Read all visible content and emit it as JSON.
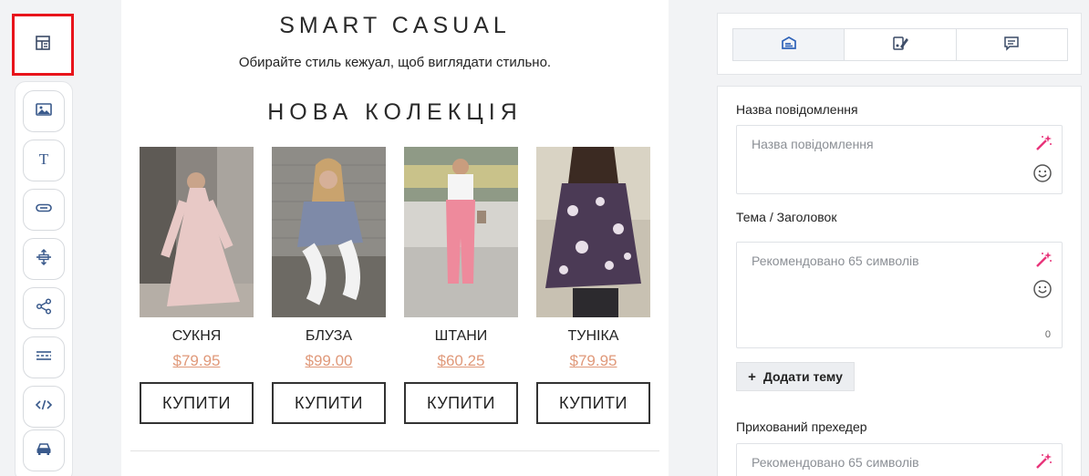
{
  "rail": {
    "top_icon": "layout-block-icon",
    "tools": [
      {
        "name": "image-block",
        "icon": "image-icon"
      },
      {
        "name": "text-block",
        "icon": "text-icon"
      },
      {
        "name": "button-block",
        "icon": "button-icon"
      },
      {
        "name": "spacer-block",
        "icon": "spacer-icon"
      },
      {
        "name": "social-block",
        "icon": "share-icon"
      },
      {
        "name": "divider-block",
        "icon": "divider-icon"
      },
      {
        "name": "html-block",
        "icon": "code-icon"
      },
      {
        "name": "product-block",
        "icon": "car-icon"
      }
    ]
  },
  "email": {
    "brand": "SMART CASUAL",
    "tagline": "Обирайте стиль кежуал, щоб виглядати стильно.",
    "collection_title": "НОВА  КОЛЕКЦІЯ",
    "products": [
      {
        "name": "СУКНЯ",
        "price": "$79.95",
        "button": "КУПИТИ"
      },
      {
        "name": "БЛУЗА",
        "price": "$99.00",
        "button": "КУПИТИ"
      },
      {
        "name": "ШТАНИ",
        "price": "$60.25",
        "button": "КУПИТИ"
      },
      {
        "name": "ТУНІКА",
        "price": "$79.95",
        "button": "КУПИТИ"
      }
    ]
  },
  "panel": {
    "tabs": [
      {
        "name": "settings-tab",
        "icon": "email-card-icon",
        "active": true
      },
      {
        "name": "style-tab",
        "icon": "paint-icon",
        "active": false
      },
      {
        "name": "comments-tab",
        "icon": "comment-icon",
        "active": false
      }
    ],
    "message_name_label": "Назва повідомлення",
    "message_name_placeholder": "Назва повідомлення",
    "subject_label": "Тема / Заголовок",
    "subject_placeholder": "Рекомендовано 65 символів",
    "subject_counter": "0",
    "add_subject_button": "Додати тему",
    "preheader_label": "Прихований прехедер",
    "preheader_placeholder": "Рекомендовано 65 символів"
  },
  "colors": {
    "highlight_border": "#e8141b",
    "price": "#e0997a",
    "magic_icon": "#e8347a",
    "icon_blue": "#3a5a8c"
  }
}
